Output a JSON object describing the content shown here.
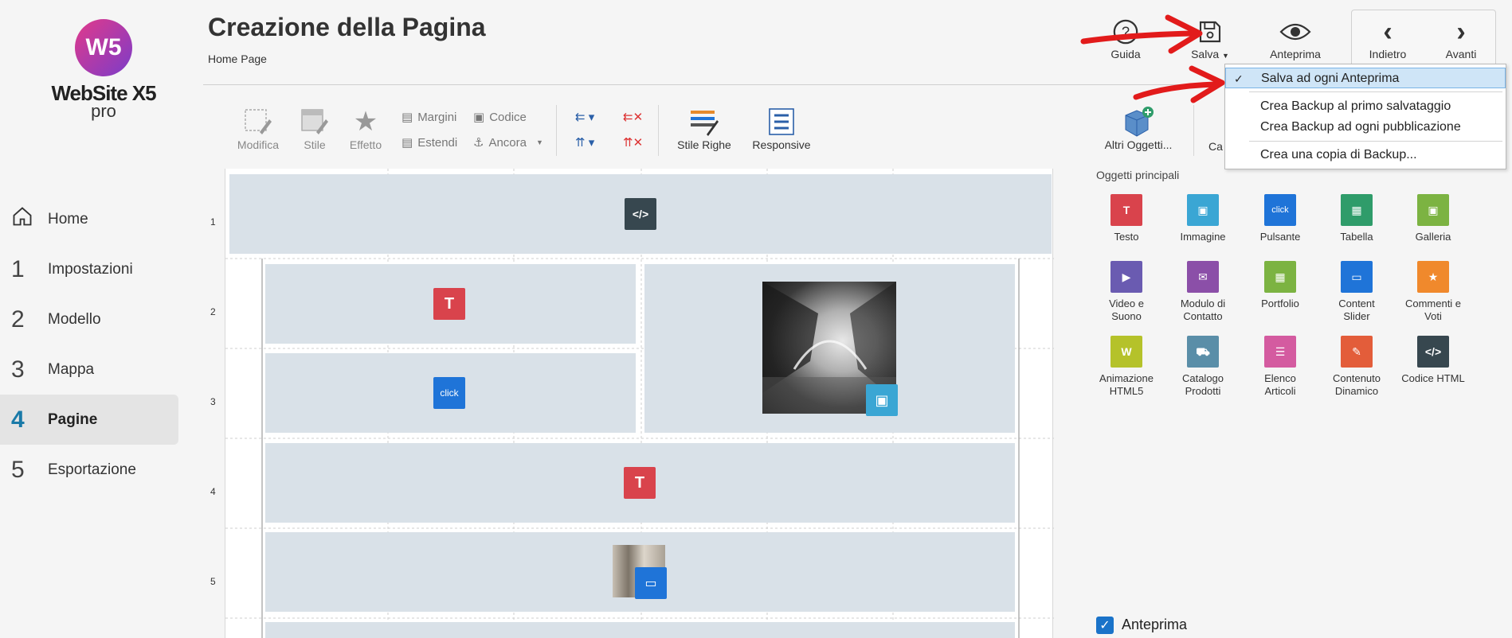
{
  "app": {
    "logo_glyph": "W5",
    "logo_name": "WebSite X5",
    "logo_sub": "pro"
  },
  "nav": [
    {
      "num": "",
      "label": "Home",
      "icon": "home-icon"
    },
    {
      "num": "1",
      "label": "Impostazioni"
    },
    {
      "num": "2",
      "label": "Modello"
    },
    {
      "num": "3",
      "label": "Mappa"
    },
    {
      "num": "4",
      "label": "Pagine",
      "active": true
    },
    {
      "num": "5",
      "label": "Esportazione"
    }
  ],
  "header": {
    "title": "Creazione della Pagina",
    "breadcrumb": "Home Page",
    "buttons": {
      "guida": "Guida",
      "salva": "Salva",
      "anteprima": "Anteprima",
      "indietro": "Indietro",
      "avanti": "Avanti"
    }
  },
  "toolbar": {
    "modifica": "Modifica",
    "stile": "Stile",
    "effetto": "Effetto",
    "margini": "Margini",
    "codice": "Codice",
    "estendi": "Estendi",
    "ancora": "Ancora",
    "stile_righe": "Stile Righe",
    "responsive": "Responsive",
    "altri_oggetti": "Altri Oggetti...",
    "cat": "Ca"
  },
  "grid": {
    "rows": [
      "1",
      "2",
      "3",
      "4",
      "5"
    ],
    "click_label": "click"
  },
  "panel": {
    "section_title": "Oggetti principali",
    "objects": [
      {
        "label": "Testo",
        "color": "#d9434c",
        "icon": "text-icon",
        "glyph": "T"
      },
      {
        "label": "Immagine",
        "color": "#3aa6d4",
        "icon": "image-icon",
        "glyph": "▣"
      },
      {
        "label": "Pulsante",
        "color": "#1f74d8",
        "icon": "button-icon",
        "glyph": "click"
      },
      {
        "label": "Tabella",
        "color": "#2f9c6a",
        "icon": "table-icon",
        "glyph": "▦"
      },
      {
        "label": "Galleria",
        "color": "#7cb342",
        "icon": "gallery-icon",
        "glyph": "▣"
      },
      {
        "label": "Video e\nSuono",
        "color": "#6a5bb1",
        "icon": "video-icon",
        "glyph": "▶"
      },
      {
        "label": "Modulo di\nContatto",
        "color": "#8b4fa8",
        "icon": "mail-icon",
        "glyph": "✉"
      },
      {
        "label": "Portfolio",
        "color": "#7cb342",
        "icon": "portfolio-icon",
        "glyph": "▦"
      },
      {
        "label": "Content\nSlider",
        "color": "#1f74d8",
        "icon": "slider-icon",
        "glyph": "▭"
      },
      {
        "label": "Commenti e\nVoti",
        "color": "#f0892c",
        "icon": "star-icon",
        "glyph": "★"
      },
      {
        "label": "Animazione\nHTML5",
        "color": "#b5c22a",
        "icon": "animation-icon",
        "glyph": "W"
      },
      {
        "label": "Catalogo\nProdotti",
        "color": "#5a8ea8",
        "icon": "cart-icon",
        "glyph": "⛟"
      },
      {
        "label": "Elenco\nArticoli",
        "color": "#d45ba0",
        "icon": "list-icon",
        "glyph": "☰"
      },
      {
        "label": "Contenuto\nDinamico",
        "color": "#e35d3a",
        "icon": "dynamic-icon",
        "glyph": "✎"
      },
      {
        "label": "Codice HTML",
        "color": "#37474f",
        "icon": "code-icon",
        "glyph": "</>"
      }
    ]
  },
  "menu": {
    "items": [
      {
        "label": "Salva ad ogni Anteprima",
        "checked": true
      },
      {
        "label": "Crea Backup al primo salvataggio"
      },
      {
        "label": "Crea Backup ad ogni pubblicazione"
      },
      {
        "label": "Crea una copia di Backup..."
      }
    ]
  },
  "footer": {
    "anteprima_checkbox": "Anteprima"
  },
  "colors": {
    "accent": "#1a7aa8",
    "cell_bg": "#d9e1e8",
    "annotation_red": "#e21b1b"
  }
}
